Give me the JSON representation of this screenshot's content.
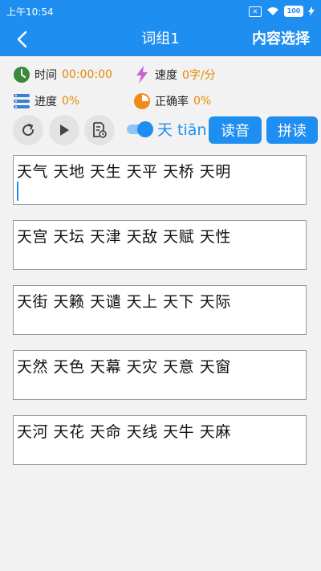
{
  "status_bar": {
    "time": "上午10:54",
    "battery": "100"
  },
  "app_bar": {
    "title": "词组1",
    "action": "内容选择"
  },
  "stats": {
    "time_label": "时间",
    "time_value": "00:00:00",
    "speed_label": "速度",
    "speed_value": "0字/分",
    "progress_label": "进度",
    "progress_value": "0%",
    "accuracy_label": "正确率",
    "accuracy_value": "0%"
  },
  "controls": {
    "pinyin_toggle_on": true,
    "character": "天 tiān",
    "read_button": "读音",
    "spell_button": "拼读"
  },
  "word_groups": [
    "天气 天地 天生 天平 天桥 天明",
    "天宫 天坛 天津 天敌 天赋 天性",
    "天街 天籁 天谴 天上 天下 天际",
    "天然 天色 天幕 天灾 天意 天窗",
    "天河 天花 天命 天线 天牛 天麻"
  ],
  "colors": {
    "primary": "#1e8ef0",
    "value": "#e58a00",
    "clock_icon": "#3a8a3a",
    "speed_icon": "#c860d0",
    "accuracy_icon": "#f08a1a"
  }
}
